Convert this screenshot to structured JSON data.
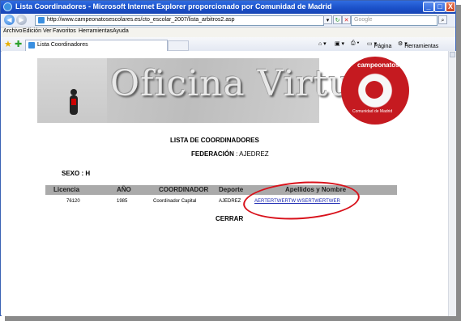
{
  "window": {
    "title": "Lista Coordinadores - Microsoft Internet Explorer proporcionado por Comunidad de Madrid",
    "minimize": "_",
    "maximize": "□",
    "close": "X"
  },
  "addressbar": {
    "url": "http://www.campeonatosescolares.es/cto_escolar_2007/lista_arbitros2.asp",
    "search_placeholder": "Google"
  },
  "menu": [
    "Archivo",
    "Edición",
    "Ver",
    "Favoritos",
    "Herramientas",
    "Ayuda"
  ],
  "tabs": {
    "active": "Lista Coordinadores"
  },
  "toolbar_right": {
    "page": "Página",
    "tools": "Herramientas"
  },
  "banner": {
    "logo_text": "Oficina Virtual",
    "badge_text_top": "campeonatos",
    "badge_text_bottom": "Comunidad de Madrid"
  },
  "page": {
    "heading": "LISTA DE COORDINADORES",
    "federation_label": "FEDERACIÓN",
    "federation_value": ": AJEDREZ",
    "sexo": "SEXO : H",
    "close": "CERRAR"
  },
  "table": {
    "headers": [
      "Licencia",
      "AÑO",
      "COORDINADOR",
      "Deporte",
      "Apellidos y Nombre"
    ],
    "rows": [
      [
        "76120",
        "1985",
        "Coordinador Capital",
        "AJEDREZ",
        "AERTERTWERTW WSERTWERTWER"
      ]
    ]
  },
  "colors": {
    "annotation": "#d8101a",
    "link": "#1d2ab2",
    "table_header": "#aaaaaa"
  }
}
